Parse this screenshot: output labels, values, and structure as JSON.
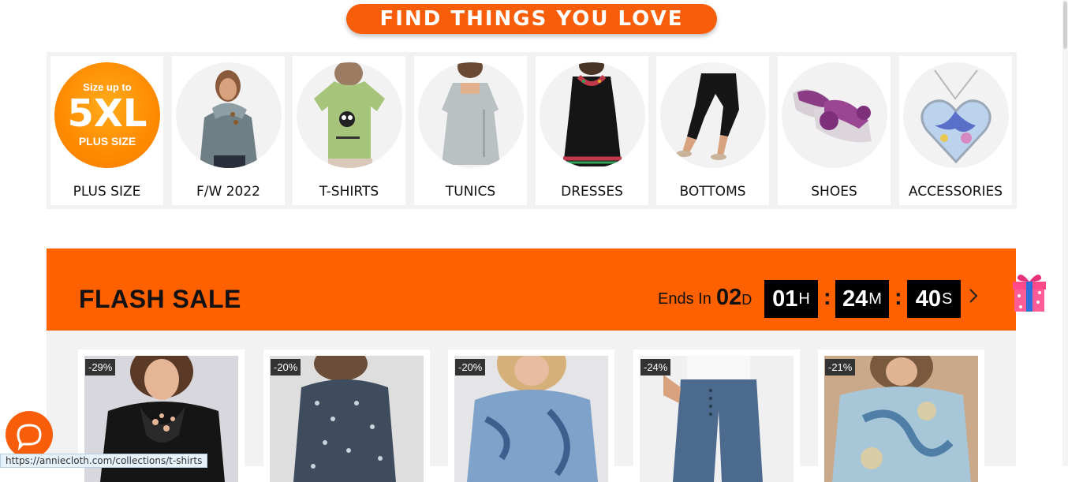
{
  "banner": {
    "text": "FIND THINGS YOU LOVE"
  },
  "categories": [
    {
      "label": "PLUS SIZE",
      "badge_top": "Size up to",
      "badge_main": "5XL",
      "badge_bottom": "PLUS SIZE"
    },
    {
      "label": "F/W 2022"
    },
    {
      "label": "T-SHIRTS"
    },
    {
      "label": "TUNICS"
    },
    {
      "label": "DRESSES"
    },
    {
      "label": "BOTTOMS"
    },
    {
      "label": "SHOES"
    },
    {
      "label": "ACCESSORIES"
    }
  ],
  "flash_sale": {
    "title": "FLASH SALE",
    "ends_in_label": "Ends In",
    "days_value": "02",
    "days_unit": "D",
    "hours_value": "01",
    "hours_unit": "H",
    "minutes_value": "24",
    "minutes_unit": "M",
    "seconds_value": "40",
    "seconds_unit": "S",
    "separator": ":"
  },
  "products": [
    {
      "discount": "-29%"
    },
    {
      "discount": "-20%"
    },
    {
      "discount": "-20%"
    },
    {
      "discount": "-24%"
    },
    {
      "discount": "-21%"
    }
  ],
  "status_bar": {
    "url": "https://anniecloth.com/collections/t-shirts"
  },
  "colors": {
    "brand_orange": "#ff6100",
    "banner_orange": "#f85e0a"
  },
  "icons": [
    "chevron-right-icon",
    "gift-icon",
    "chat-icon"
  ]
}
